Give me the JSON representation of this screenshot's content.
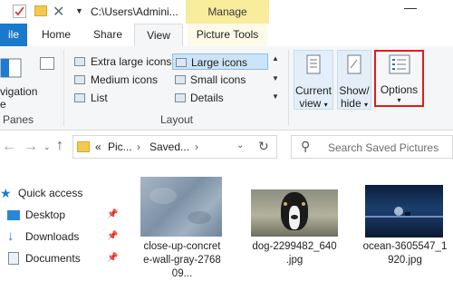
{
  "titlebar": {
    "path": "C:\\Users\\Admini...",
    "contextual_tab": "Manage"
  },
  "ribbon_tabs": [
    "ile",
    "Home",
    "Share",
    "View",
    "Picture Tools"
  ],
  "ribbon": {
    "panes": {
      "nav_label": "vigation",
      "nav_sub": "e",
      "group": "Panes"
    },
    "layout": {
      "items": [
        "Extra large icons",
        "Large icons",
        "Medium icons",
        "Small icons",
        "List",
        "Details"
      ],
      "selected": "Large icons",
      "group": "Layout"
    },
    "current_view": {
      "line1": "Current",
      "line2": "view"
    },
    "show_hide": {
      "line1": "Show/",
      "line2": "hide"
    },
    "options": {
      "label": "Options"
    }
  },
  "address": {
    "crumbs": [
      "«",
      "Pic...",
      "›",
      "Saved...",
      "›"
    ],
    "search_placeholder": "Search Saved Pictures"
  },
  "nav": {
    "items": [
      "Quick access",
      "Desktop",
      "Downloads",
      "Documents"
    ]
  },
  "files": [
    {
      "caption_l1": "close-up-concret",
      "caption_l2": "e-wall-gray-2768",
      "caption_l3": "09..."
    },
    {
      "caption_l1": "dog-2299482_640",
      "caption_l2": ".jpg",
      "caption_l3": ""
    },
    {
      "caption_l1": "ocean-3605547_1",
      "caption_l2": "920.jpg",
      "caption_l3": ""
    }
  ],
  "colors": {
    "file_tab": "#1979ca",
    "manage_tab": "#f8ec9d",
    "options_highlight": "#e21a1a",
    "ribbon_bg": "#f5f6f7",
    "selected": "#cce4f7"
  }
}
